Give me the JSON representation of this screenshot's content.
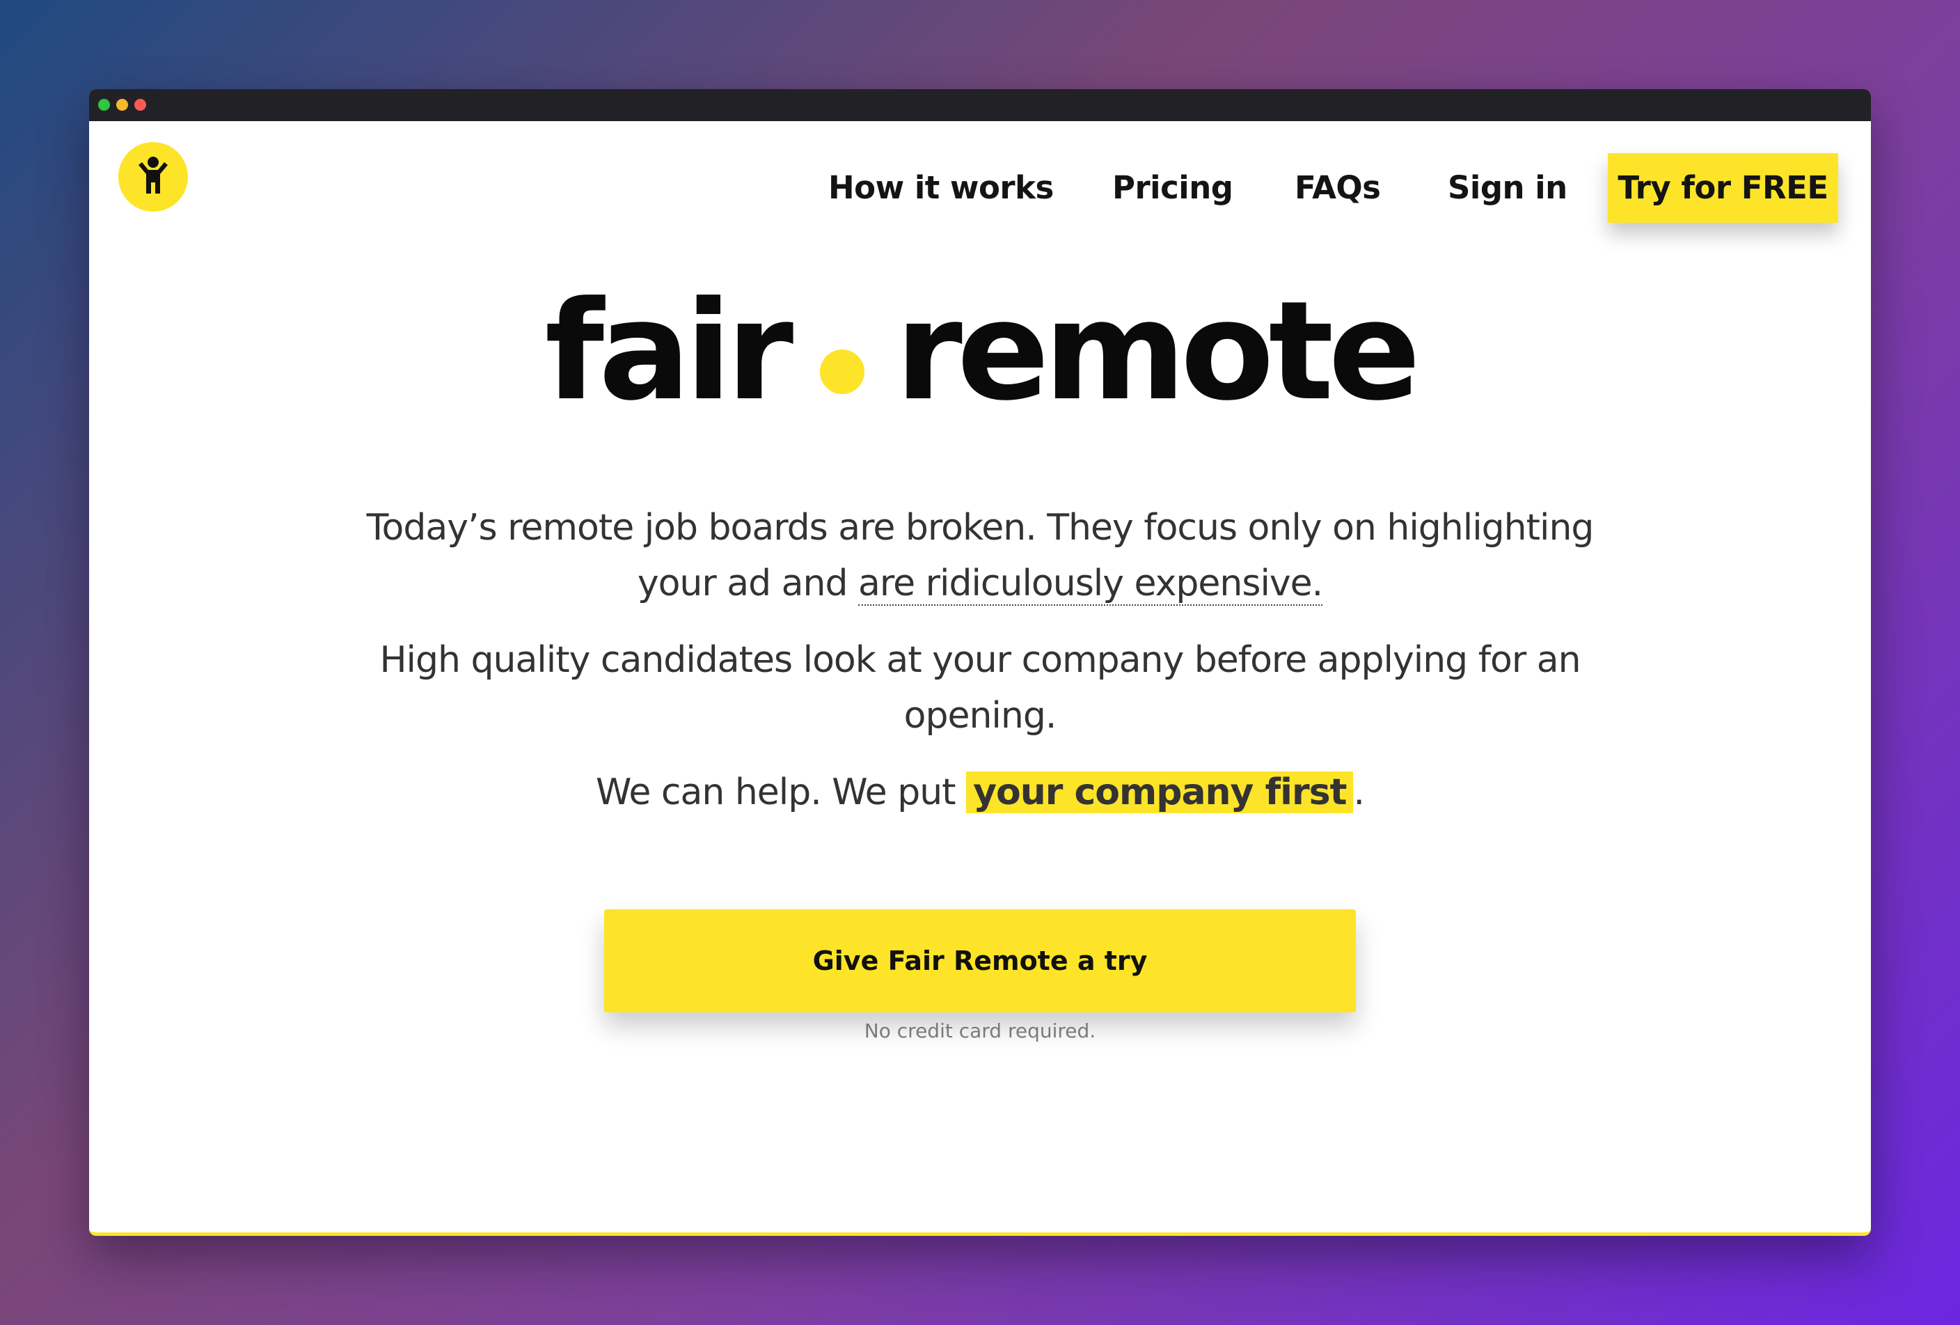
{
  "window": {
    "controls": [
      "green-dot",
      "yellow-dot",
      "red-dot"
    ]
  },
  "logo": {
    "icon": "person-raising-arm-icon",
    "color": "#fde428"
  },
  "nav": {
    "items": [
      {
        "label": "How it works"
      },
      {
        "label": "Pricing"
      },
      {
        "label": "FAQs"
      },
      {
        "label": "Sign in"
      }
    ],
    "cta_label": "Try for FREE"
  },
  "hero": {
    "title_part1": "fair",
    "title_part2": "remote",
    "paragraph1_text": "Today’s remote job boards are broken. They focus only on highlighting your ad and ",
    "paragraph1_underlined": "are ridiculously expensive.",
    "paragraph2": "High quality candidates look at your company before applying for an opening.",
    "paragraph3_prefix": "We can help. We put ",
    "paragraph3_highlight": "your company first",
    "paragraph3_suffix": ".",
    "cta_label": "Give Fair Remote a try",
    "cta_note": "No credit card required."
  },
  "colors": {
    "accent": "#fde428",
    "text": "#141414",
    "titlebar": "#222226"
  }
}
